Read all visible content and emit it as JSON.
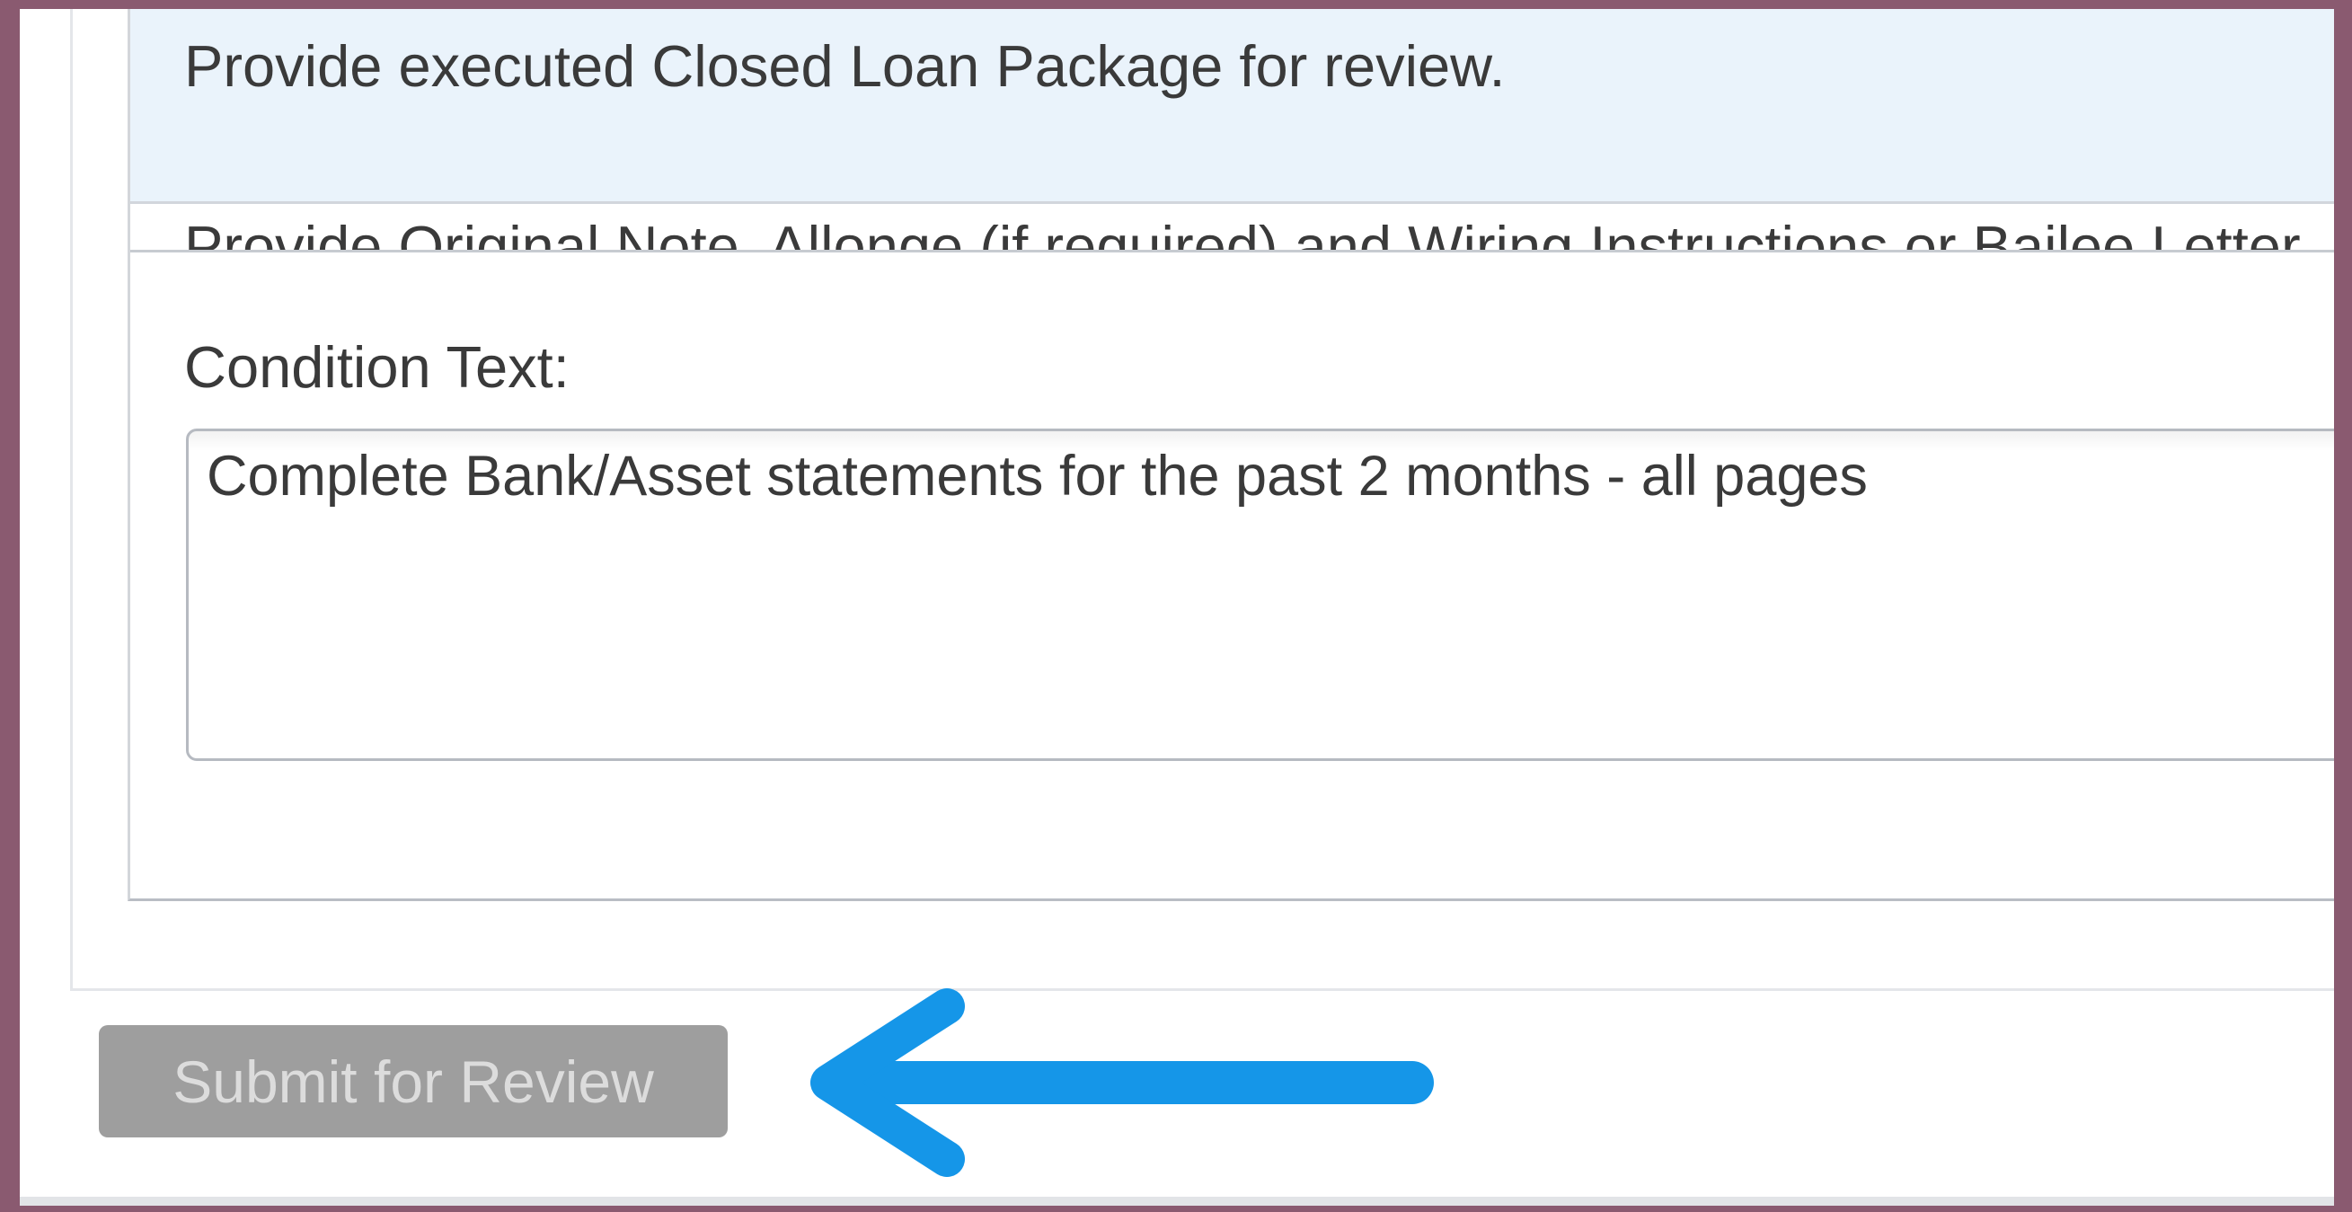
{
  "conditions": {
    "row_1_text": "Provide executed Closed Loan Package for review.",
    "row_2_text": "Provide Original Note, Allonge (if required) and Wiring Instructions or Bailee Letter"
  },
  "editor": {
    "label": "Condition Text:",
    "value": "Complete Bank/Asset statements for the past 2 months - all pages"
  },
  "actions": {
    "submit_label": "Submit for Review",
    "submit_disabled": true
  },
  "annotation": {
    "arrow_icon": "arrow-left-icon",
    "arrow_color": "#1596e8"
  },
  "colors": {
    "frame": "#8a5a70",
    "row_highlight": "#eaf3fb",
    "button_disabled_bg": "#9e9e9e"
  }
}
